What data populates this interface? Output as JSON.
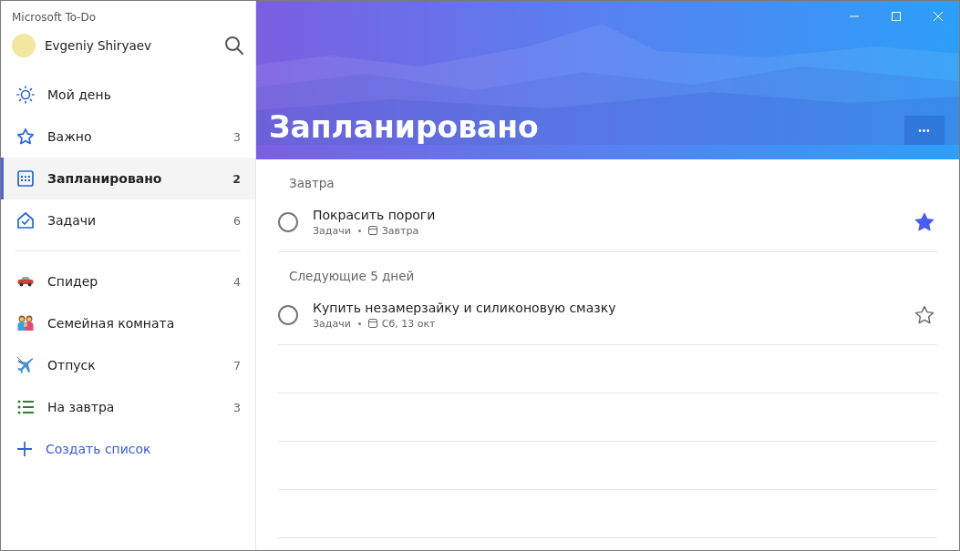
{
  "window": {
    "title": "Microsoft To-Do"
  },
  "user": {
    "name": "Evgeniy Shiryaev"
  },
  "sidebar": {
    "smart_lists": [
      {
        "kind": "sun",
        "label": "Мой день",
        "selected": false
      },
      {
        "kind": "star",
        "label": "Важно",
        "count": "3",
        "selected": false
      },
      {
        "kind": "calendar",
        "label": "Запланировано",
        "count": "2",
        "selected": true
      },
      {
        "kind": "home",
        "label": "Задачи",
        "count": "6",
        "selected": false
      }
    ],
    "lists": [
      {
        "kind": "car",
        "label": "Спидер",
        "count": "4",
        "selected": false
      },
      {
        "kind": "family",
        "label": "Семейная комната",
        "selected": false
      },
      {
        "kind": "plane",
        "label": "Отпуск",
        "count": "7",
        "selected": false
      },
      {
        "kind": "list",
        "label": "На завтра",
        "count": "3",
        "selected": false
      }
    ],
    "new_list": "Создать список"
  },
  "header": {
    "title": "Запланировано",
    "more_button": "•••"
  },
  "sections": [
    {
      "heading": "Завтра",
      "tasks": [
        {
          "title": "Покрасить пороги",
          "list": "Задачи",
          "due": "Завтра",
          "important": true,
          "completed": false
        }
      ]
    },
    {
      "heading": "Следующие 5 дней",
      "tasks": [
        {
          "title": "Купить незамерзайку и силиконовую смазку",
          "list": "Задачи",
          "due": "Сб, 13 окт",
          "important": false,
          "completed": false
        }
      ]
    }
  ]
}
